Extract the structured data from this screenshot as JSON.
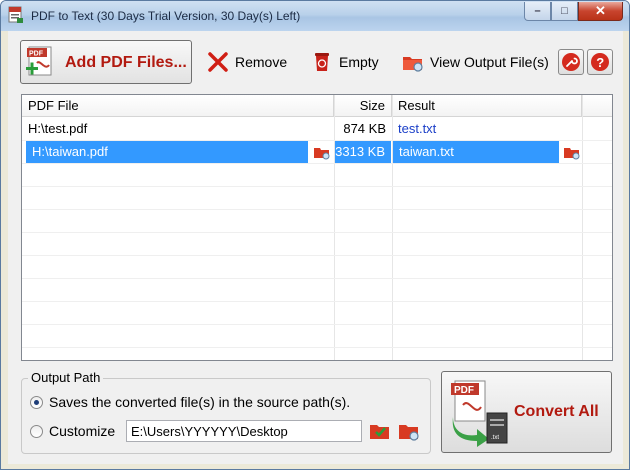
{
  "window": {
    "title": "PDF to Text (30 Days Trial Version, 30 Day(s) Left)",
    "controls": {
      "minimize": "–",
      "maximize": "□",
      "close": "✕"
    }
  },
  "toolbar": {
    "add_label": "Add PDF Files...",
    "remove_label": "Remove",
    "empty_label": "Empty",
    "view_output_label": "View Output File(s)",
    "settings_icon": "wrench-icon",
    "help_icon": "help-icon"
  },
  "file_list": {
    "columns": {
      "file": "PDF File",
      "size": "Size",
      "result": "Result"
    },
    "rows": [
      {
        "file": "H:\\test.pdf",
        "size": "874 KB",
        "result": "test.txt",
        "selected": false
      },
      {
        "file": "H:\\taiwan.pdf",
        "size": "3313 KB",
        "result": "taiwan.txt",
        "selected": true
      }
    ]
  },
  "output_path": {
    "group_label": "Output Path",
    "option_source": "Saves the converted file(s) in the source path(s).",
    "option_customize": "Customize",
    "selected_option": "source",
    "custom_path": "E:\\Users\\YYYYYY\\Desktop"
  },
  "convert": {
    "label": "Convert All"
  },
  "colors": {
    "accent_red": "#b21a10",
    "selection": "#3399ff",
    "link_blue": "#1b3fc8"
  }
}
